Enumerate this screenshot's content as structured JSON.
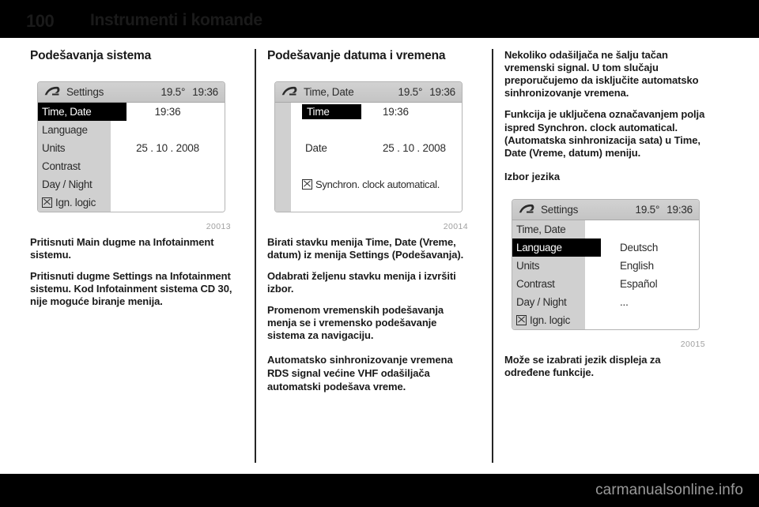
{
  "header": {
    "page_number": "100",
    "title": "Instrumenti i komande"
  },
  "footer": {
    "watermark": "carmanualsonline.info"
  },
  "columns": {
    "left": {
      "heading": "Podešavanja sistema",
      "figure": {
        "code": "20013",
        "icon": "settings-swoosh-icon",
        "title": "Settings",
        "temperature": "19.5°",
        "clock": "19:36",
        "menu": [
          {
            "label": "Time, Date",
            "selected": true,
            "checkbox": false
          },
          {
            "label": "Language",
            "selected": false,
            "checkbox": false
          },
          {
            "label": "Units",
            "selected": false,
            "checkbox": false
          },
          {
            "label": "Contrast",
            "selected": false,
            "checkbox": false
          },
          {
            "label": "Day / Night",
            "selected": false,
            "checkbox": false
          },
          {
            "label": "Ign. logic",
            "selected": false,
            "checkbox": true
          }
        ],
        "values": {
          "time": "19:36",
          "date": "25 . 10 . 2008"
        }
      },
      "paragraphs": [
        "Pritisnuti Main dugme na Infotainment sistemu.",
        "Pritisnuti dugme Settings na Infotainment sistemu. Kod Infotainment sistema CD 30, nije moguće biranje menija."
      ]
    },
    "middle": {
      "heading": "Podešavanje datuma i vremena",
      "figure": {
        "code": "20014",
        "icon": "settings-swoosh-icon",
        "title": "Time, Date",
        "temperature": "19.5°",
        "clock": "19:36",
        "rows": [
          {
            "label": "Time",
            "value": "19:36",
            "selected": true
          },
          {
            "label": "Date",
            "value": "25 . 10 . 2008",
            "selected": false
          }
        ],
        "checkbox_row": "Synchron. clock automatical."
      },
      "paragraphs": [
        "Birati stavku menija Time, Date (Vreme, datum) iz menija Settings (Podešavanja).",
        "Odabrati željenu stavku menija i izvršiti izbor.",
        "Promenom vremenskih podešavanja menja se i vremensko podešavanje sistema za navigaciju."
      ],
      "subheading": "Automatsko sinhronizovanje vremena",
      "subparagraph": "RDS signal većine VHF odašiljača automatski podešava vreme."
    },
    "right": {
      "paragraphs": [
        "Nekoliko odašiljača ne šalju tačan vremenski signal. U tom slučaju preporučujemo da isključite automatsko sinhronizovanje vremena.",
        "Funkcija je uključena označavanjem polja ispred Synchron. clock automatical. (Automatska sinhronizacija sata) u Time, Date (Vreme, datum) meniju."
      ],
      "heading": "Izbor jezika",
      "figure": {
        "code": "20015",
        "icon": "settings-swoosh-icon",
        "title": "Settings",
        "temperature": "19.5°",
        "clock": "19:36",
        "menu": [
          {
            "label": "Time, Date",
            "selected": false,
            "checkbox": false
          },
          {
            "label": "Language",
            "selected": true,
            "checkbox": false
          },
          {
            "label": "Units",
            "selected": false,
            "checkbox": false
          },
          {
            "label": "Contrast",
            "selected": false,
            "checkbox": false
          },
          {
            "label": "Day / Night",
            "selected": false,
            "checkbox": false
          },
          {
            "label": "Ign. logic",
            "selected": false,
            "checkbox": true
          }
        ],
        "languages": [
          "Deutsch",
          "English",
          "Español",
          "..."
        ]
      },
      "closing_paragraph": "Može se izabrati jezik displeja za određene funkcije."
    }
  }
}
